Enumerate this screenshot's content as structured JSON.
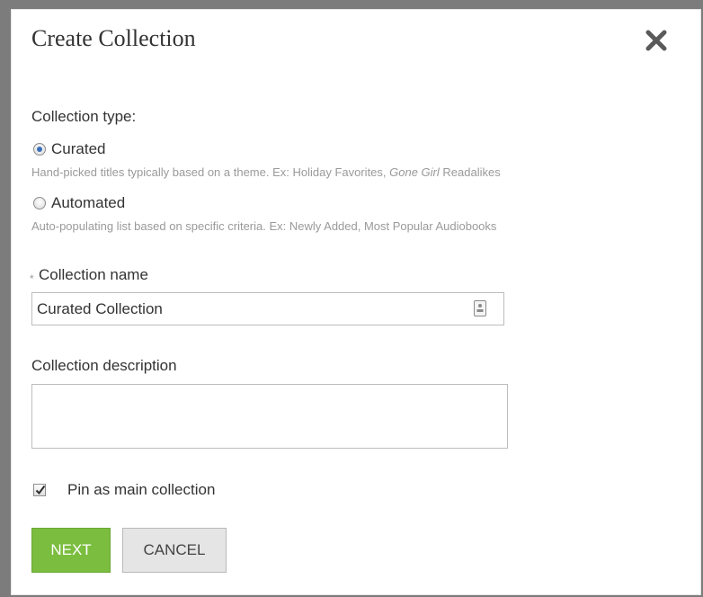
{
  "dialog": {
    "title": "Create Collection",
    "close_icon": "close-x-icon"
  },
  "collection_type": {
    "label": "Collection type:",
    "options": [
      {
        "label": "Curated",
        "checked": true,
        "hint_before": "Hand-picked titles typically based on a theme. Ex: Holiday Favorites, ",
        "hint_italic": "Gone Girl",
        "hint_after": " Readalikes"
      },
      {
        "label": "Automated",
        "checked": false,
        "hint": "Auto-populating list based on specific criteria. Ex: Newly Added, Most Popular Audiobooks"
      }
    ]
  },
  "name_field": {
    "required_marker": "*",
    "label": "Collection name",
    "value": "Curated Collection",
    "icon": "contact-card-icon"
  },
  "description_field": {
    "label": "Collection description",
    "value": ""
  },
  "pin": {
    "label": "Pin as main collection",
    "checked": true
  },
  "buttons": {
    "next": "NEXT",
    "cancel": "CANCEL"
  },
  "colors": {
    "primary_button": "#7bbd3f",
    "radio_selected": "#3b6fb8"
  }
}
